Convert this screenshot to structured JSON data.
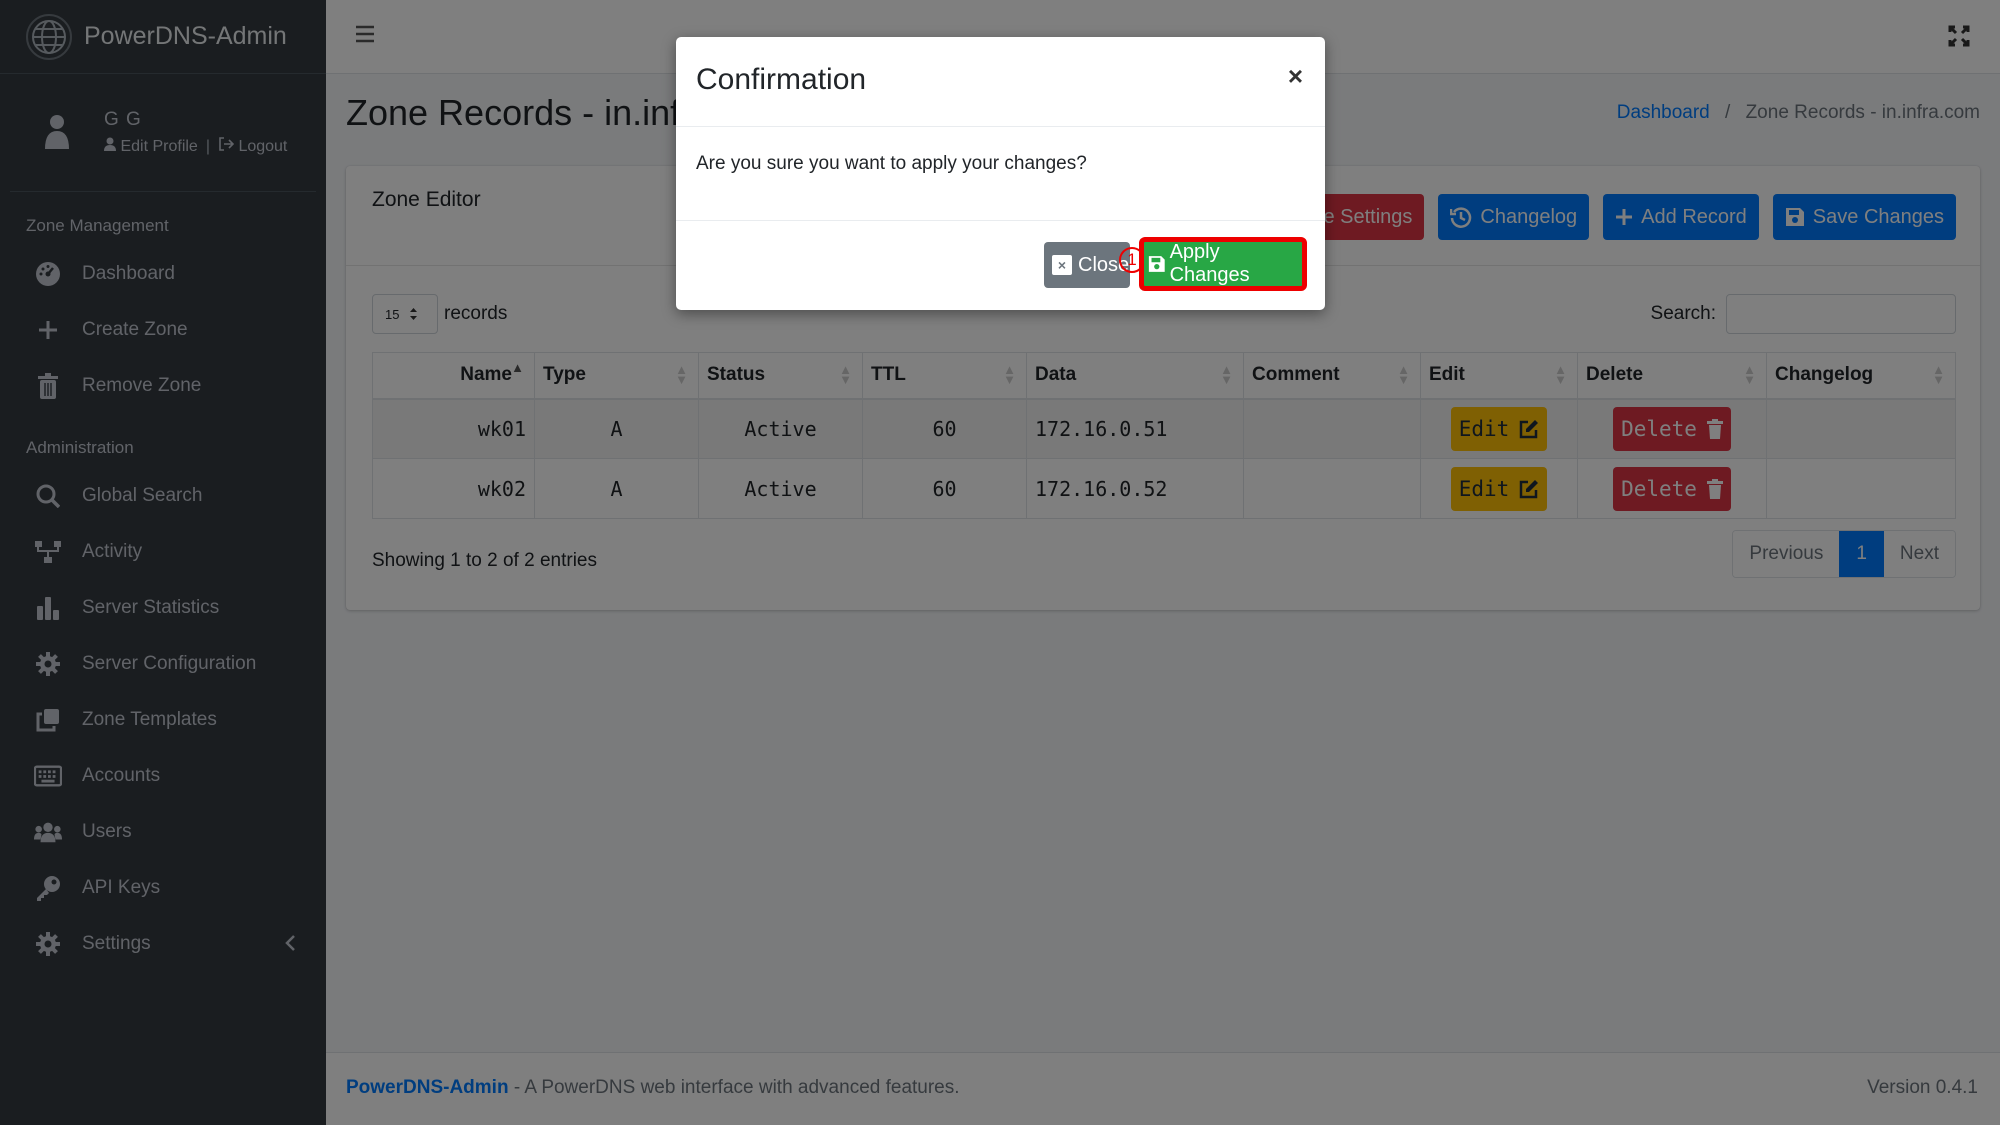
{
  "app": {
    "title": "PowerDNS-Admin"
  },
  "user": {
    "name": "G G",
    "edit_profile": "Edit Profile",
    "logout": "Logout"
  },
  "sidebar": {
    "section_zone": "Zone Management",
    "section_admin": "Administration",
    "items": [
      {
        "label": "Dashboard",
        "icon": "dashboard-icon"
      },
      {
        "label": "Create Zone",
        "icon": "plus-icon"
      },
      {
        "label": "Remove Zone",
        "icon": "trash-icon"
      },
      {
        "label": "Global Search",
        "icon": "search-icon"
      },
      {
        "label": "Activity",
        "icon": "network-icon"
      },
      {
        "label": "Server Statistics",
        "icon": "bar-chart-icon"
      },
      {
        "label": "Server Configuration",
        "icon": "gear-icon"
      },
      {
        "label": "Zone Templates",
        "icon": "clone-icon"
      },
      {
        "label": "Accounts",
        "icon": "keyboard-icon"
      },
      {
        "label": "Users",
        "icon": "users-icon"
      },
      {
        "label": "API Keys",
        "icon": "key-icon"
      },
      {
        "label": "Settings",
        "icon": "gear-icon"
      }
    ]
  },
  "header": {
    "page_title": "Zone Records - in.infr",
    "breadcrumb_home": "Dashboard",
    "breadcrumb_sep": "/",
    "breadcrumb_current": "Zone Records - in.infra.com"
  },
  "card": {
    "title": "Zone Editor",
    "buttons": {
      "zone_settings": "Zone Settings",
      "changelog": "Changelog",
      "add_record": "Add Record",
      "save_changes": "Save Changes"
    },
    "page_length": "15",
    "records_label": "records",
    "search_label": "Search:",
    "search_value": ""
  },
  "table": {
    "columns": [
      "Name",
      "Type",
      "Status",
      "TTL",
      "Data",
      "Comment",
      "Edit",
      "Delete",
      "Changelog"
    ],
    "rows": [
      {
        "name": "wk01",
        "type": "A",
        "status": "Active",
        "ttl": "60",
        "data": "172.16.0.51",
        "comment": "",
        "edit": "Edit",
        "delete": "Delete"
      },
      {
        "name": "wk02",
        "type": "A",
        "status": "Active",
        "ttl": "60",
        "data": "172.16.0.52",
        "comment": "",
        "edit": "Edit",
        "delete": "Delete"
      }
    ],
    "showing": "Showing 1 to 2 of 2 entries",
    "pager": {
      "prev": "Previous",
      "current": "1",
      "next": "Next"
    }
  },
  "modal": {
    "title": "Confirmation",
    "close_x": "×",
    "body": "Are you sure you want to apply your changes?",
    "close_btn": "Close",
    "apply_btn": "Apply Changes",
    "marker": "1"
  },
  "footer": {
    "brand": "PowerDNS-Admin",
    "tagline": " - A PowerDNS web interface with advanced features.",
    "version": "Version 0.4.1"
  },
  "colors": {
    "primary": "#007bff",
    "danger": "#dc3545",
    "warning": "#ffc107",
    "success": "#28a745",
    "sidebar": "#343a40",
    "highlight": "#ee0000"
  }
}
